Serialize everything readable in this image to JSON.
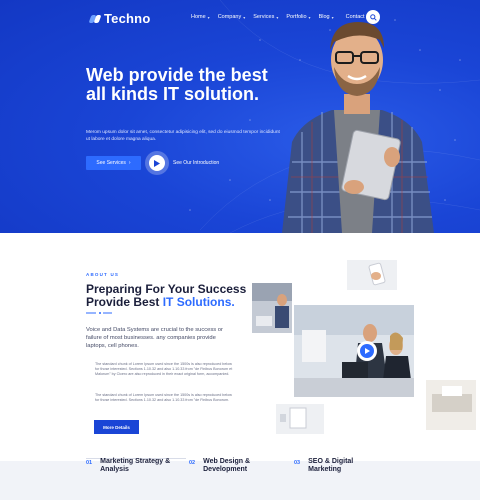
{
  "brand": {
    "name": "Techno",
    "accent": "#2d6bff",
    "hero_bg": "#1a45d6"
  },
  "nav": {
    "items": [
      {
        "label": "Home",
        "has_dropdown": true
      },
      {
        "label": "Company",
        "has_dropdown": true
      },
      {
        "label": "Services",
        "has_dropdown": true
      },
      {
        "label": "Portfolio",
        "has_dropdown": true
      },
      {
        "label": "Blog",
        "has_dropdown": true
      }
    ],
    "contact_label": "Contact",
    "search_icon": "search-icon"
  },
  "hero": {
    "title": "Web provide the best all kinds IT solution.",
    "description": "Merom upsum dolor sit amet, consectetur adipisicing elit, sed do eiusmod tempor incididunt ut labore et dolore magna aliqua.",
    "primary_button": "See Services",
    "intro_link": "See Our Introduction"
  },
  "about": {
    "eyebrow": "ABOUT US",
    "title_part1": "Preparing For Your Success Provide Best ",
    "title_accent": "IT Solutions.",
    "lead": "Voice and Data Systems are crucial to the success or failure of most businesses. any companies provide laptops, cell phones.",
    "paragraphs": [
      "The standard chunk of Lorem Ipsum used since the 1500s is also reproduced below for those interested. Sections 1.10.32 and also 1.10.33 from \"de Finibus Bonorum et Malorum\" by Cicero are also reproduced in their exact original form, accompanied.",
      "The standard chunk of Lorem Ipsum used since the 1500s is also reproduced below for those interested. Sections 1.10.32 and also 1.10.33 from \"de Finibus Bonorum."
    ],
    "button": "More Details"
  },
  "services": [
    {
      "num": "01",
      "title": "Marketing Strategy & Analysis"
    },
    {
      "num": "02",
      "title": "Web Design & Development"
    },
    {
      "num": "03",
      "title": "SEO & Digital Marketing"
    }
  ]
}
